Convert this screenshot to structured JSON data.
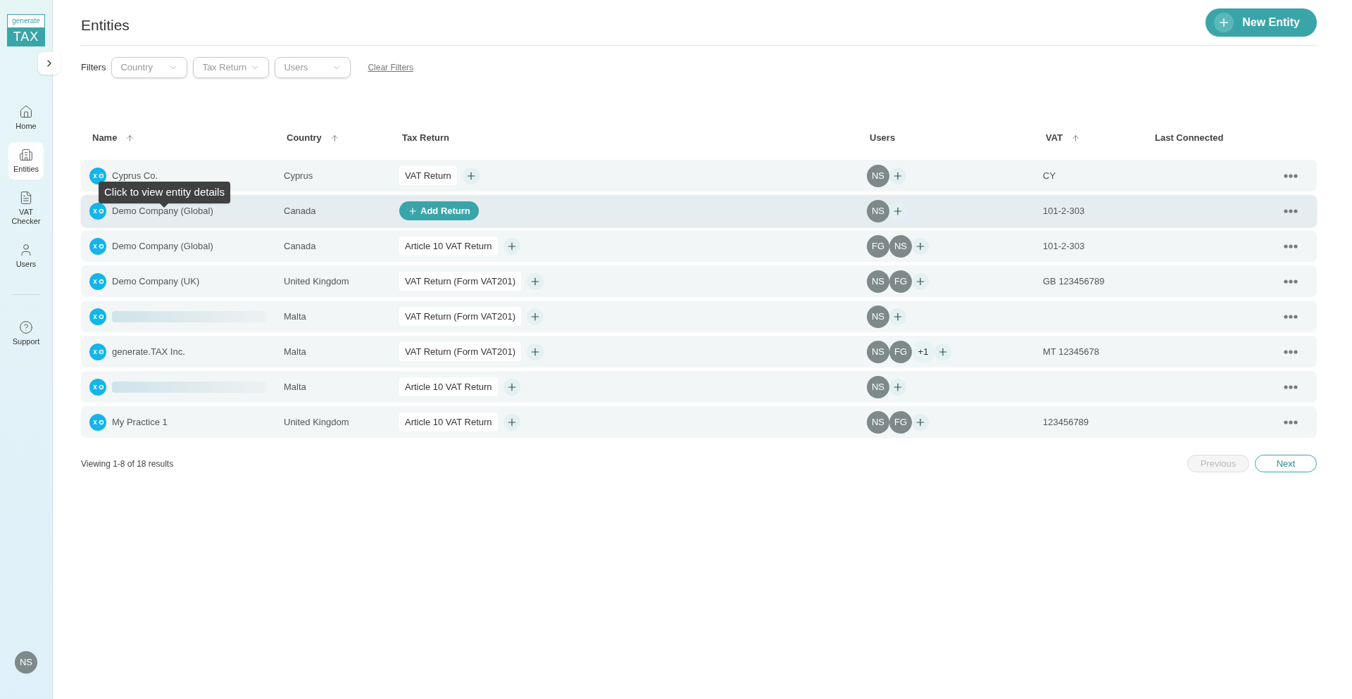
{
  "logo": {
    "top": "generate",
    "bottom": "TAX"
  },
  "sidebar": {
    "items": [
      {
        "label": "Home",
        "selected": false
      },
      {
        "label": "Entities",
        "selected": true
      },
      {
        "label": "VAT Checker",
        "selected": false
      },
      {
        "label": "Users",
        "selected": false
      },
      {
        "label": "Support",
        "selected": false
      }
    ],
    "user_avatar": "NS"
  },
  "page": {
    "title": "Entities",
    "new_button": "New Entity"
  },
  "filters": {
    "label": "Filters",
    "dropdowns": [
      {
        "placeholder": "Country"
      },
      {
        "placeholder": "Tax Return"
      },
      {
        "placeholder": "Users"
      }
    ],
    "clear": "Clear Filters"
  },
  "table": {
    "columns": [
      {
        "label": "Name",
        "sortable": true
      },
      {
        "label": "Country",
        "sortable": true
      },
      {
        "label": "Tax Return",
        "sortable": false
      },
      {
        "label": "Users",
        "sortable": false
      },
      {
        "label": "VAT",
        "sortable": true
      },
      {
        "label": "Last Connected",
        "sortable": false
      }
    ],
    "rows": [
      {
        "name": "Cyprus Co.",
        "redacted": false,
        "country": "Cyprus",
        "tax_return": {
          "kind": "tag",
          "label": "VAT Return"
        },
        "users": [
          "NS"
        ],
        "vat": "CY",
        "highlighted": false
      },
      {
        "name": "Demo Company (Global)",
        "redacted": false,
        "country": "Canada",
        "tax_return": {
          "kind": "add",
          "label": "Add Return"
        },
        "users": [
          "NS"
        ],
        "vat": "101-2-303",
        "highlighted": true
      },
      {
        "name": "Demo Company (Global)",
        "redacted": false,
        "country": "Canada",
        "tax_return": {
          "kind": "tag",
          "label": "Article 10 VAT Return"
        },
        "users": [
          "FG",
          "NS"
        ],
        "vat": "101-2-303",
        "highlighted": false
      },
      {
        "name": "Demo Company (UK)",
        "redacted": false,
        "country": "United Kingdom",
        "tax_return": {
          "kind": "tag",
          "label": "VAT Return (Form VAT201)"
        },
        "users": [
          "NS",
          "FG"
        ],
        "vat": "GB 123456789",
        "highlighted": false
      },
      {
        "redacted": true,
        "country": "Malta",
        "tax_return": {
          "kind": "tag",
          "label": "VAT Return (Form VAT201)"
        },
        "users": [
          "NS"
        ],
        "highlighted": false
      },
      {
        "name": "generate.TAX Inc.",
        "redacted": false,
        "country": "Malta",
        "tax_return": {
          "kind": "tag",
          "label": "VAT Return (Form VAT201)"
        },
        "users": [
          "NS",
          "FG"
        ],
        "more_users": "+1",
        "vat": "MT 12345678",
        "highlighted": false
      },
      {
        "redacted": true,
        "country": "Malta",
        "tax_return": {
          "kind": "tag",
          "label": "Article 10 VAT Return"
        },
        "users": [
          "NS"
        ],
        "highlighted": false
      },
      {
        "name": "My Practice 1",
        "redacted": false,
        "country": "United Kingdom",
        "tax_return": {
          "kind": "tag",
          "label": "Article 10 VAT Return"
        },
        "users": [
          "NS",
          "FG"
        ],
        "vat": "123456789",
        "highlighted": false
      }
    ]
  },
  "tooltip": {
    "text": "Click to view entity details"
  },
  "pagination": {
    "summary": "Viewing 1-8 of 18 results",
    "previous": {
      "label": "Previous",
      "disabled": true
    },
    "next": {
      "label": "Next",
      "disabled": false
    }
  }
}
